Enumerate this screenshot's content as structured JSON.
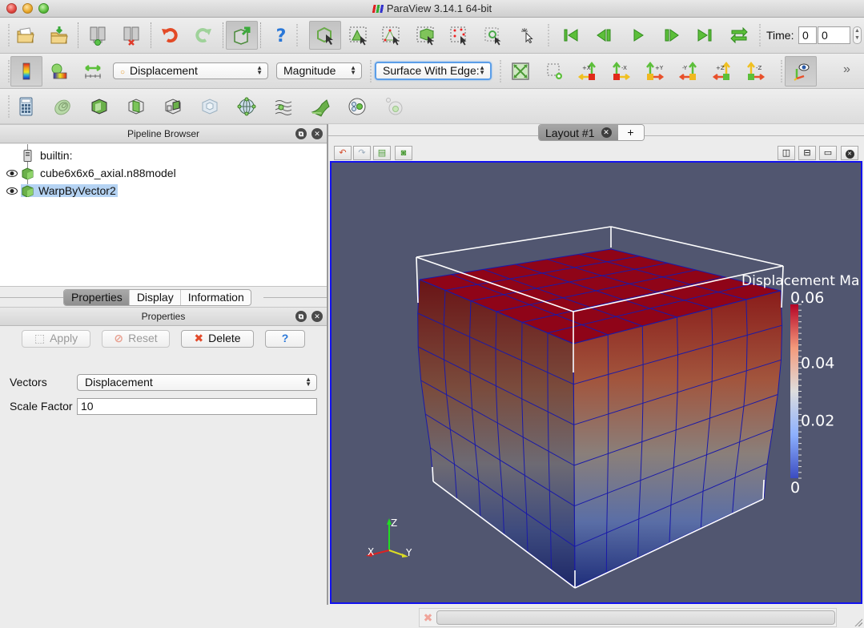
{
  "window": {
    "title": "ParaView 3.14.1 64-bit",
    "controls": [
      "close",
      "minimize",
      "zoom"
    ]
  },
  "toolbar_main": {
    "buttons": [
      {
        "name": "open-icon",
        "tooltip": "Open"
      },
      {
        "name": "load-state-icon",
        "tooltip": "Load State"
      },
      {
        "name": "connect-icon",
        "tooltip": "Connect"
      },
      {
        "name": "disconnect-icon",
        "tooltip": "Disconnect"
      },
      {
        "name": "undo-icon",
        "tooltip": "Undo"
      },
      {
        "name": "redo-icon",
        "tooltip": "Redo"
      },
      {
        "name": "auto-apply-icon",
        "tooltip": "Auto Apply",
        "active": true
      },
      {
        "name": "help-icon",
        "tooltip": "Help"
      },
      {
        "name": "interact-icon",
        "tooltip": "Interact",
        "active": true
      },
      {
        "name": "select-cells-surface-icon",
        "tooltip": "Select Cells On"
      },
      {
        "name": "select-points-surface-icon",
        "tooltip": "Select Points On"
      },
      {
        "name": "select-cells-through-icon",
        "tooltip": "Select Cells Through"
      },
      {
        "name": "select-points-through-icon",
        "tooltip": "Select Points Through"
      },
      {
        "name": "select-block-icon",
        "tooltip": "Select Block"
      },
      {
        "name": "interactive-select-icon",
        "tooltip": "Interactive Select"
      },
      {
        "name": "first-frame-icon",
        "tooltip": "First Frame"
      },
      {
        "name": "previous-frame-icon",
        "tooltip": "Previous Frame"
      },
      {
        "name": "play-icon",
        "tooltip": "Play"
      },
      {
        "name": "next-frame-icon",
        "tooltip": "Next Frame"
      },
      {
        "name": "last-frame-icon",
        "tooltip": "Last Frame"
      },
      {
        "name": "loop-icon",
        "tooltip": "Loop"
      }
    ],
    "time_label": "Time:",
    "time_value": "0",
    "time_index": "0"
  },
  "toolbar_display": {
    "color_by": "Displacement",
    "component": "Magnitude",
    "representation": "Surface With Edges",
    "representation_visible": "Surface With Edge:",
    "more_label": "»"
  },
  "pipeline_browser": {
    "title": "Pipeline Browser",
    "items": [
      {
        "label": "builtin:",
        "type": "server",
        "visible": null
      },
      {
        "label": "cube6x6x6_axial.n88model",
        "type": "source",
        "visible": true
      },
      {
        "label": "WarpByVector2",
        "type": "filter",
        "visible": true,
        "selected": true
      }
    ]
  },
  "panel_tabs": {
    "tabs": [
      "Properties",
      "Display",
      "Information"
    ],
    "active": "Properties"
  },
  "properties": {
    "title": "Properties",
    "apply_label": "Apply",
    "reset_label": "Reset",
    "delete_label": "Delete",
    "help_label": "?",
    "fields": [
      {
        "label": "Vectors",
        "value": "Displacement",
        "type": "select"
      },
      {
        "label": "Scale Factor",
        "value": "10",
        "type": "text"
      }
    ]
  },
  "layout": {
    "tab_label": "Layout #1",
    "add_label": "+",
    "view_buttons": [
      "split-horizontal",
      "split-vertical",
      "maximize",
      "close"
    ]
  },
  "render_view": {
    "background_color": "#515670",
    "mesh_edge_color": "#1a1aa8",
    "outline_color": "#ffffff",
    "scalar_bar": {
      "title": "Displacement Ma",
      "max_label": "0.06",
      "ticks": [
        "0.06",
        "0.04",
        "0.02",
        "0"
      ],
      "range": [
        0,
        0.06
      ],
      "colormap": [
        "#3b4cc0",
        "#8db0fe",
        "#dddddd",
        "#f49a7b",
        "#b40426"
      ]
    },
    "axes": {
      "x": "X",
      "y": "Y",
      "z": "Z"
    },
    "mesh_resolution": 6
  },
  "status": {
    "progress_cancel": "✖",
    "progress": 0
  }
}
